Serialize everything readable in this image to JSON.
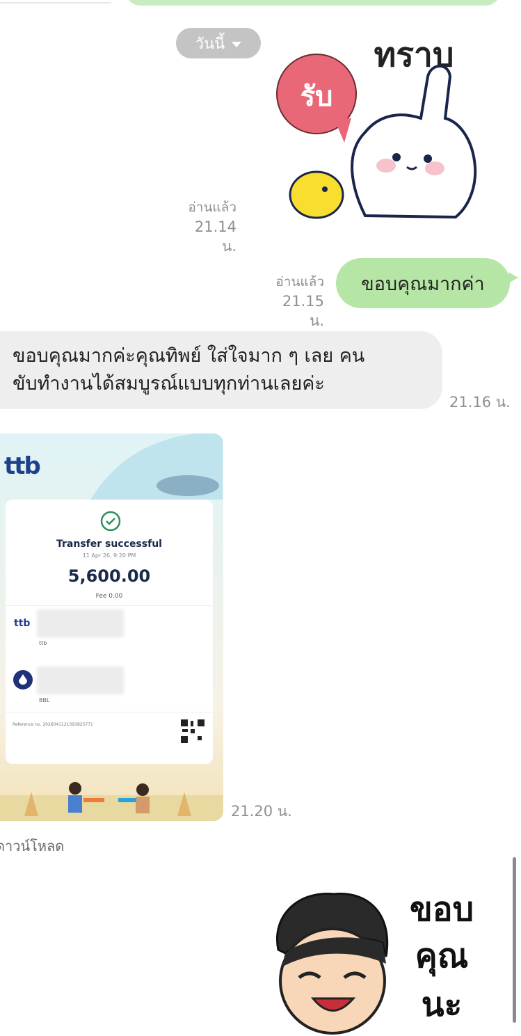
{
  "date_pill": {
    "label": "วันนี้"
  },
  "sticker_1": {
    "text_top": "ทราบ",
    "text_bubble": "รับ",
    "read": "อ่านแล้ว",
    "time": "21.14 น."
  },
  "message_out": {
    "text": "ขอบคุณมากค่า",
    "read": "อ่านแล้ว",
    "time": "21.15 น."
  },
  "message_in": {
    "line1": "ขอบคุณมากค่ะคุณทิพย์ ใส่ใจมาก ๆ เลย คน",
    "line2": "ขับทำงานได้สมบูรณ์แบบทุกท่านเลยค่ะ",
    "time": "21.16 น."
  },
  "slip": {
    "bank_logo": "ttb",
    "title": "Transfer successful",
    "datetime": "11 Apr 26, 9:20 PM",
    "amount": "5,600.00",
    "fee_label": "Fee",
    "fee_value": "0.00",
    "from_bank": "ttb",
    "to_bank": "BBL",
    "reference_label": "Reference no.",
    "reference_value": "2026041121093825771",
    "time": "21.20 น.",
    "download": "ดาวน์โหลด"
  },
  "sticker_2": {
    "line1": "ขอบ",
    "line2": "คุณ",
    "line3": "นะ"
  }
}
